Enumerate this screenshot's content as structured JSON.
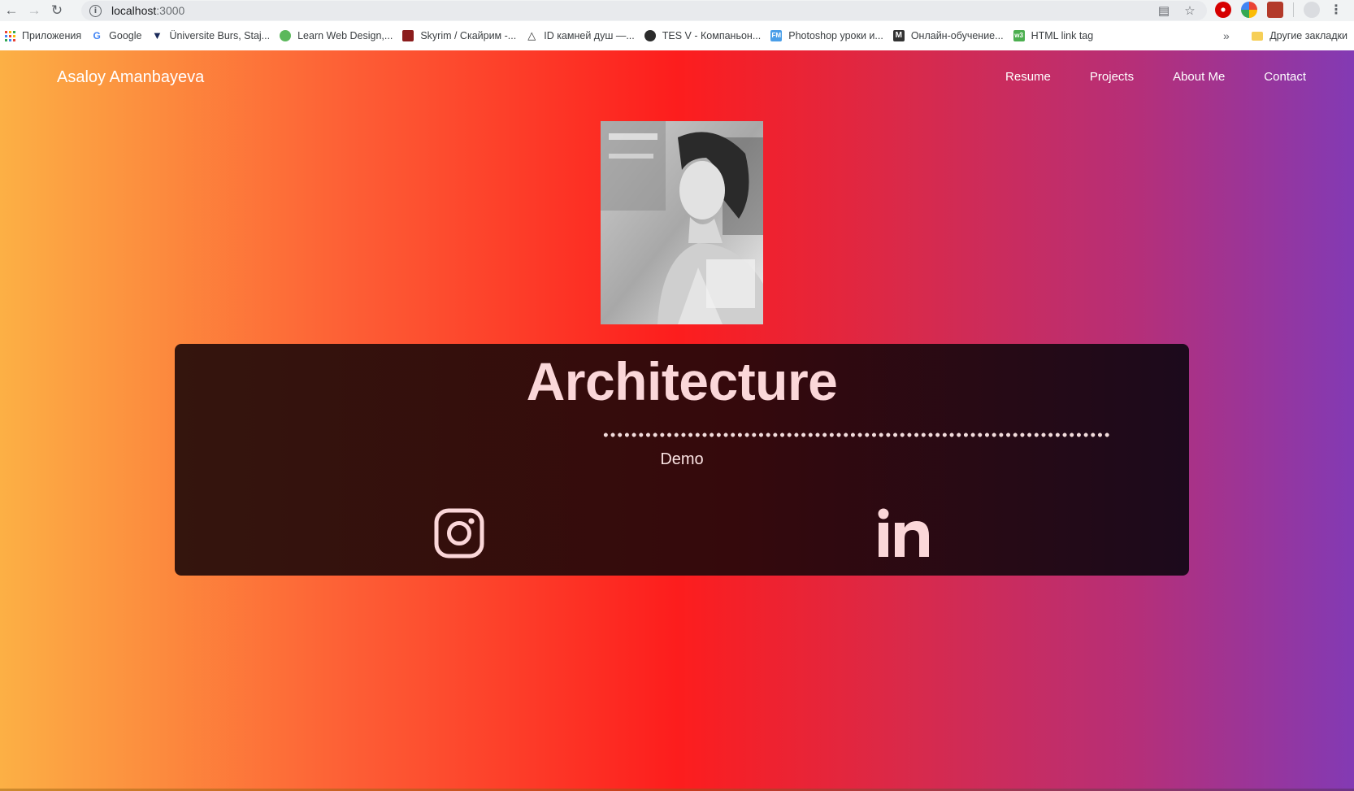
{
  "browser": {
    "url_host": "localhost",
    "url_port": ":3000",
    "bookmarks": [
      {
        "label": "Приложения",
        "icon": "apps-grid-icon"
      },
      {
        "label": "Google",
        "icon": "google-icon"
      },
      {
        "label": "Üniversite Burs, Staj...",
        "icon": "tie-icon"
      },
      {
        "label": "Learn Web Design,...",
        "icon": "green-leaf-icon"
      },
      {
        "label": "Skyrim / Скайрим -...",
        "icon": "skyrim-icon"
      },
      {
        "label": "ID камней душ —...",
        "icon": "triangle-icon"
      },
      {
        "label": "TES V - Компаньон...",
        "icon": "tes-icon"
      },
      {
        "label": "Photoshop уроки и...",
        "icon": "fm-icon"
      },
      {
        "label": "Онлайн-обучение...",
        "icon": "m-icon"
      },
      {
        "label": "HTML link tag",
        "icon": "w3-icon"
      }
    ],
    "more_bookmarks": "»",
    "other_bookmarks": "Другие закладки"
  },
  "site": {
    "brand": "Asaloy Amanbayeva",
    "nav": [
      "Resume",
      "Projects",
      "About Me",
      "Contact"
    ]
  },
  "card": {
    "title": "Architecture",
    "subtitle": "Demo",
    "links": [
      "instagram-icon",
      "linkedin-icon"
    ]
  },
  "colors": {
    "gradient": [
      "#fcb045",
      "#fd1d1d",
      "#833ab4"
    ],
    "card_text": "#fbd7d9",
    "card_bg": "#300d0e"
  }
}
